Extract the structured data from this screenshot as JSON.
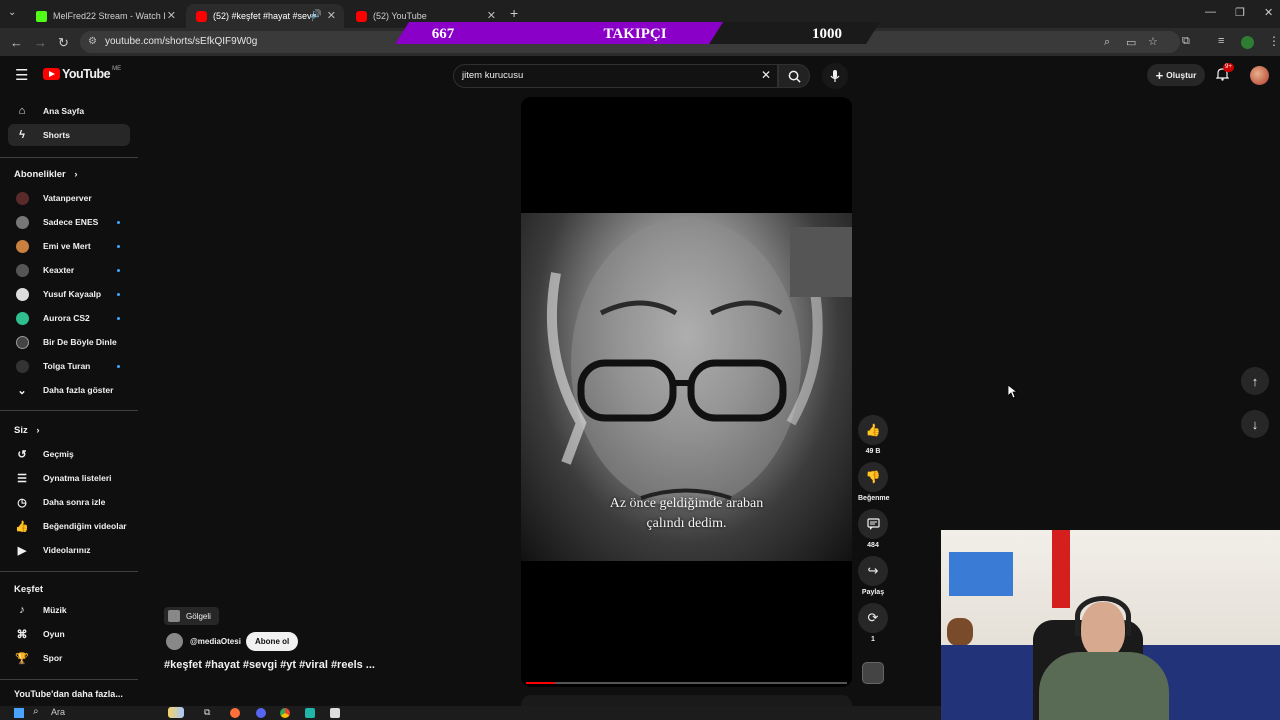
{
  "browser": {
    "tabs": [
      {
        "title": "MelFred22 Stream - Watch Liv",
        "favicon_color": "#53fc18",
        "active": false
      },
      {
        "title": "(52) #keşfet #hayat #sevgi",
        "favicon_color": "#ff0000",
        "active": true
      },
      {
        "title": "(52) YouTube",
        "favicon_color": "#ff0000",
        "active": false
      }
    ],
    "new_tab": "+",
    "url": "youtube.com/shorts/sEfkQIF9W0g"
  },
  "overlay": {
    "current": "667",
    "label": "TAKIPÇI",
    "goal": "1000",
    "progress": 0.667,
    "color": "#8b00c8"
  },
  "youtube": {
    "logo_text": "YouTube",
    "region": "ME",
    "search_value": "jitem kurucusu",
    "create_label": "Oluştur",
    "notification_count": "9+",
    "nav": [
      {
        "label": "Ana Sayfa",
        "icon": "home-icon"
      },
      {
        "label": "Shorts",
        "icon": "shorts-icon",
        "active": true
      }
    ],
    "subscriptions_header": "Abonelikler",
    "subscriptions": [
      {
        "label": "Vatanperver",
        "color": "#5a2a2a",
        "dot": false
      },
      {
        "label": "Sadece ENES",
        "color": "#777777",
        "dot": true
      },
      {
        "label": "Emi ve Mert",
        "color": "#c9803f",
        "dot": true
      },
      {
        "label": "Keaxter",
        "color": "#555555",
        "dot": true
      },
      {
        "label": "Yusuf Kayaalp",
        "color": "#dddddd",
        "dot": true
      },
      {
        "label": "Aurora CS2",
        "color": "#2fbf8f",
        "dot": true
      },
      {
        "label": "Bir De Böyle Dinle",
        "color": "#444444",
        "dot": false
      },
      {
        "label": "Tolga Turan",
        "color": "#333333",
        "dot": true
      }
    ],
    "show_more": "Daha fazla göster",
    "you_header": "Siz",
    "you_items": [
      {
        "label": "Geçmiş",
        "icon": "history-icon"
      },
      {
        "label": "Oynatma listeleri",
        "icon": "playlist-icon"
      },
      {
        "label": "Daha sonra izle",
        "icon": "clock-icon"
      },
      {
        "label": "Beğendiğim videolar",
        "icon": "like-icon"
      },
      {
        "label": "Videolarınız",
        "icon": "video-icon"
      }
    ],
    "explore_header": "Keşfet",
    "explore_items": [
      {
        "label": "Müzik",
        "icon": "music-icon"
      },
      {
        "label": "Oyun",
        "icon": "gaming-icon"
      },
      {
        "label": "Spor",
        "icon": "trophy-icon"
      }
    ],
    "more_from": "YouTube'dan daha fazla..."
  },
  "short": {
    "subtitle_line1": "Az önce geldiğimde araban",
    "subtitle_line2": "çalındı dedim.",
    "sound_label": "Gölgeli",
    "channel": "@mediaOtesi",
    "subscribe_label": "Abone ol",
    "title": "#keşfet #hayat #sevgi #yt #viral #reels ...",
    "likes": "49 B",
    "dislike_label": "Beğenme",
    "comments": "484",
    "share_label": "Paylaş",
    "remix_count": "1",
    "progress": 0.09
  },
  "taskbar": {
    "search_placeholder": "Ara"
  }
}
